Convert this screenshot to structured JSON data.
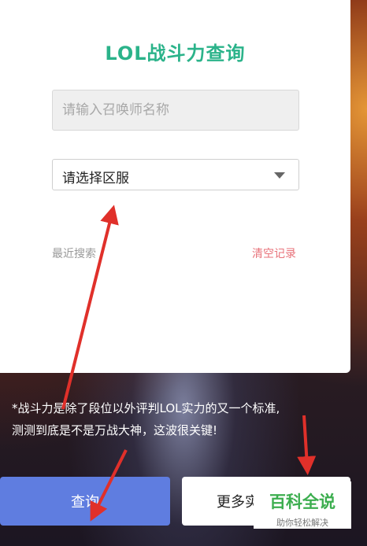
{
  "card": {
    "title": "LOL战斗力查询",
    "name_placeholder": "请输入召唤师名称",
    "server_select_label": "请选择区服",
    "recent_label": "最近搜索",
    "clear_label": "清空记录"
  },
  "note": {
    "line1": "*战斗力是除了段位以外评判LOL实力的又一个标准,",
    "line2": "测测到底是不是万战大神，这波很关键!"
  },
  "buttons": {
    "query_label": "查询",
    "more_label": "更多实"
  },
  "watermark": {
    "title": "百科全说",
    "subtitle": "助你轻松解决"
  },
  "colors": {
    "title": "#2bb38a",
    "clear_link": "#e8727a",
    "query_button": "#5f7de0",
    "annotation_arrow": "#e0302a",
    "watermark_green": "#3cae4f"
  },
  "icons": {
    "select_caret": "caret-down-icon",
    "annotation": "red-arrow-icon"
  }
}
